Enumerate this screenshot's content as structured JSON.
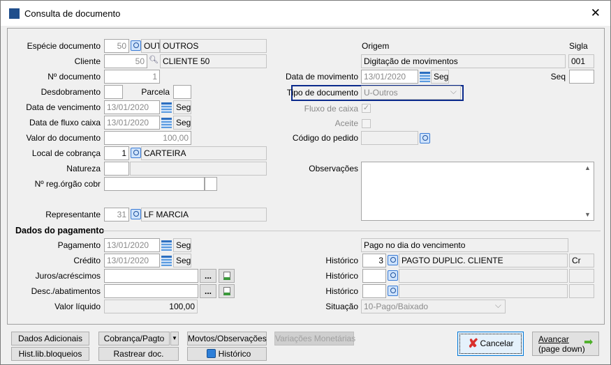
{
  "window": {
    "title": "Consulta de documento",
    "close": "✕"
  },
  "left": {
    "especie": {
      "label": "Espécie documento",
      "code": "50",
      "abbr": "OUT",
      "desc": "OUTROS"
    },
    "cliente": {
      "label": "Cliente",
      "code": "50",
      "desc": "CLIENTE 50"
    },
    "numero": {
      "label": "Nº documento",
      "value": "1"
    },
    "desdobramento": {
      "label": "Desdobramento",
      "value": ""
    },
    "parcela": {
      "label": "Parcela",
      "value": ""
    },
    "vencimento": {
      "label": "Data de vencimento",
      "value": "13/01/2020",
      "day": "Seg"
    },
    "fluxo": {
      "label": "Data de fluxo caixa",
      "value": "13/01/2020",
      "day": "Seg"
    },
    "valor": {
      "label": "Valor do documento",
      "value": "100,00"
    },
    "local": {
      "label": "Local de cobrança",
      "code": "1",
      "desc": "CARTEIRA"
    },
    "natureza": {
      "label": "Natureza",
      "code": "",
      "desc": ""
    },
    "nreg": {
      "label": "Nº reg.órgão cobr",
      "value": ""
    },
    "representante": {
      "label": "Representante",
      "code": "31",
      "desc": "LF MARCIA"
    }
  },
  "right": {
    "origem": {
      "label": "Origem",
      "value": "Digitação de movimentos"
    },
    "sigla": {
      "label": "Sigla",
      "value": "001"
    },
    "movimento": {
      "label": "Data de movimento",
      "value": "13/01/2020",
      "day": "Seg"
    },
    "seq": {
      "label": "Seq",
      "value": ""
    },
    "tipo": {
      "label": "Tipo de documento",
      "value": "U-Outros"
    },
    "fluxo_caixa": {
      "label": "Fluxo de caixa",
      "checked": true
    },
    "aceite": {
      "label": "Aceite",
      "checked": false
    },
    "pedido": {
      "label": "Código do pedido",
      "value": ""
    },
    "observacoes": {
      "label": "Observações",
      "value": ""
    }
  },
  "pagamento": {
    "section": "Dados do pagamento",
    "pagamento": {
      "label": "Pagamento",
      "value": "13/01/2020",
      "day": "Seg"
    },
    "credito": {
      "label": "Crédito",
      "value": "13/01/2020",
      "day": "Seg"
    },
    "juros": {
      "label": "Juros/acréscimos",
      "value": "",
      "dots": "..."
    },
    "desc": {
      "label": "Desc./abatimentos",
      "value": "",
      "dots": "..."
    },
    "liquido": {
      "label": "Valor líquido",
      "value": "100,00"
    },
    "nota": "Pago no dia do vencimento",
    "historicos": [
      {
        "label": "Histórico",
        "code": "3",
        "desc": "PAGTO DUPLIC. CLIENTE",
        "tipo": "Cr"
      },
      {
        "label": "Histórico",
        "code": "",
        "desc": "",
        "tipo": ""
      },
      {
        "label": "Histórico",
        "code": "",
        "desc": "",
        "tipo": ""
      }
    ],
    "situacao": {
      "label": "Situação",
      "value": "10-Pago/Baixado"
    }
  },
  "buttons": {
    "dados": "Dados Adicionais",
    "cobranca": "Cobrança/Pagto",
    "movtos": "Movtos/Observações",
    "variacoes": "Variações Monetárias",
    "hist_lib": "Hist.lib.bloqueios",
    "rastrear": "Rastrear doc.",
    "historico": "Histórico",
    "cancelar": "Cancelar",
    "avancar": "Avançar",
    "avancar_sub": "(page down)"
  },
  "colors": {
    "accent": "#0a2a8c",
    "cancel": "#d9302c",
    "next": "#4caf28"
  }
}
